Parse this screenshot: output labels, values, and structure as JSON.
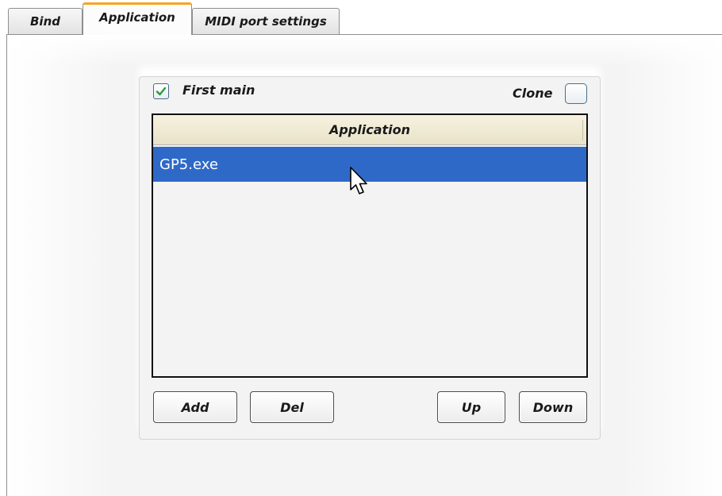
{
  "tabs": [
    {
      "label": "Bind",
      "active": false
    },
    {
      "label": "Application",
      "active": true
    },
    {
      "label": "MIDI port settings",
      "active": false
    }
  ],
  "options": {
    "first_main_label": "First main",
    "first_main_checked": true,
    "clone_label": "Clone",
    "clone_checked": false
  },
  "application_list": {
    "header": "Application",
    "rows": [
      "GP5.exe"
    ],
    "selected_index": 0
  },
  "buttons": {
    "add": "Add",
    "del": "Del",
    "up": "Up",
    "down": "Down"
  },
  "colors": {
    "active_tab_accent": "#f5a623",
    "selection": "#2f69c8",
    "check_mark": "#2e9a3a"
  },
  "icons": {
    "cursor": "mouse-pointer-icon",
    "check": "check-icon"
  }
}
